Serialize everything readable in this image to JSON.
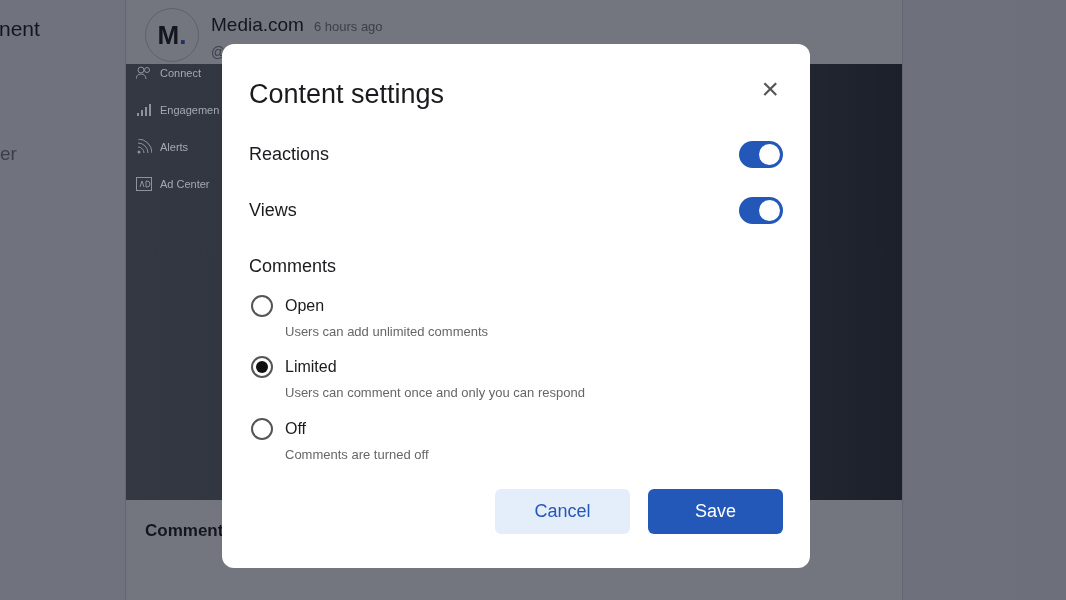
{
  "left_panel": {
    "heading": "nent",
    "item": "er"
  },
  "post": {
    "avatar": {
      "letter": "M",
      "dot": "."
    },
    "author": "Media.com",
    "time": "6 hours ago",
    "handle": "@",
    "menu": [
      {
        "label": "Connect"
      },
      {
        "label": "Engagemen"
      },
      {
        "label": "Alerts"
      },
      {
        "label": "Ad Center"
      }
    ],
    "comments_heading": "Comment"
  },
  "dialog": {
    "title": "Content settings",
    "close": "×",
    "toggles": [
      {
        "label": "Reactions",
        "on": true
      },
      {
        "label": "Views",
        "on": true
      }
    ],
    "comments": {
      "heading": "Comments",
      "options": [
        {
          "label": "Open",
          "description": "Users can add unlimited comments",
          "selected": false
        },
        {
          "label": "Limited",
          "description": "Users can comment once and only you can respond",
          "selected": true
        },
        {
          "label": "Off",
          "description": "Comments are turned off",
          "selected": false
        }
      ]
    },
    "buttons": [
      {
        "label": "Cancel",
        "kind": "secondary"
      },
      {
        "label": "Save",
        "kind": "primary"
      }
    ]
  }
}
